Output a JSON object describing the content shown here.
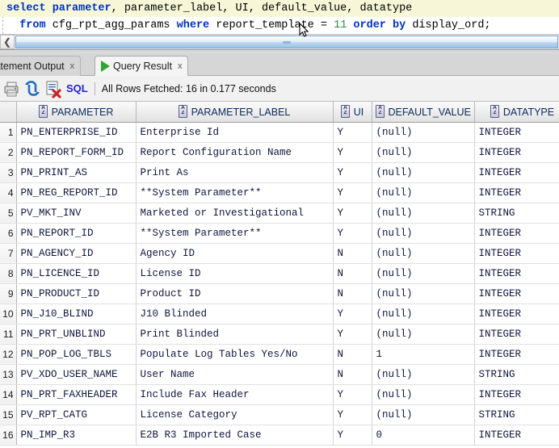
{
  "editor": {
    "line1": {
      "segments": [
        {
          "t": "select ",
          "k": true
        },
        {
          "t": "parameter",
          "k": true
        },
        {
          "t": ", parameter_label, UI, default_value, datatype",
          "k": false
        }
      ],
      "plain": "select parameter, parameter_label, UI, default_value, datatype"
    },
    "line2": {
      "plain": "  from cfg_rpt_agg_params where report_template = 11 order by display_ord;"
    },
    "scroll_left_icon": "chevron-left-icon"
  },
  "tabs": [
    {
      "label": "tatement Output",
      "close": "x",
      "active": false,
      "icon": null
    },
    {
      "label": "Query Result",
      "close": "x",
      "active": true,
      "icon": "play-icon"
    }
  ],
  "toolbar": {
    "icons": [
      "print-icon",
      "refresh-icon",
      "unpin-delete-icon"
    ],
    "sql_label": "SQL",
    "fetch_status": "All Rows Fetched: 16 in 0.177 seconds"
  },
  "grid": {
    "columns": [
      {
        "name": "PARAMETER",
        "icon": "sort-az-icon"
      },
      {
        "name": "PARAMETER_LABEL",
        "icon": "sort-az-icon"
      },
      {
        "name": "UI",
        "icon": "sort-az-icon"
      },
      {
        "name": "DEFAULT_VALUE",
        "icon": "sort-az-icon"
      },
      {
        "name": "DATATYPE",
        "icon": "sort-az-icon"
      }
    ],
    "rows": [
      {
        "n": "1",
        "parameter": "PN_ENTERPRISE_ID",
        "parameter_label": "Enterprise Id",
        "ui": "Y",
        "default_value": "(null)",
        "datatype": "INTEGER"
      },
      {
        "n": "2",
        "parameter": "PN_REPORT_FORM_ID",
        "parameter_label": "Report Configuration Name",
        "ui": "Y",
        "default_value": "(null)",
        "datatype": "INTEGER"
      },
      {
        "n": "3",
        "parameter": "PN_PRINT_AS",
        "parameter_label": "Print As",
        "ui": "Y",
        "default_value": "(null)",
        "datatype": "INTEGER"
      },
      {
        "n": "4",
        "parameter": "PN_REG_REPORT_ID",
        "parameter_label": "**System Parameter**",
        "ui": "Y",
        "default_value": "(null)",
        "datatype": "INTEGER"
      },
      {
        "n": "5",
        "parameter": "PV_MKT_INV",
        "parameter_label": "Marketed or Investigational",
        "ui": "Y",
        "default_value": "(null)",
        "datatype": "STRING"
      },
      {
        "n": "6",
        "parameter": "PN_REPORT_ID",
        "parameter_label": "**System Parameter**",
        "ui": "Y",
        "default_value": "(null)",
        "datatype": "INTEGER"
      },
      {
        "n": "7",
        "parameter": "PN_AGENCY_ID",
        "parameter_label": "Agency ID",
        "ui": "N",
        "default_value": "(null)",
        "datatype": "INTEGER"
      },
      {
        "n": "8",
        "parameter": "PN_LICENCE_ID",
        "parameter_label": "License ID",
        "ui": "N",
        "default_value": "(null)",
        "datatype": "INTEGER"
      },
      {
        "n": "9",
        "parameter": "PN_PRODUCT_ID",
        "parameter_label": "Product ID",
        "ui": "N",
        "default_value": "(null)",
        "datatype": "INTEGER"
      },
      {
        "n": "10",
        "parameter": "PN_J10_BLIND",
        "parameter_label": "J10 Blinded",
        "ui": "Y",
        "default_value": "(null)",
        "datatype": "INTEGER"
      },
      {
        "n": "11",
        "parameter": "PN_PRT_UNBLIND",
        "parameter_label": "Print Blinded",
        "ui": "Y",
        "default_value": "(null)",
        "datatype": "INTEGER"
      },
      {
        "n": "12",
        "parameter": "PN_POP_LOG_TBLS",
        "parameter_label": "Populate Log Tables Yes/No",
        "ui": "N",
        "default_value": "1",
        "datatype": "INTEGER"
      },
      {
        "n": "13",
        "parameter": "PV_XDO_USER_NAME",
        "parameter_label": "User Name",
        "ui": "N",
        "default_value": "(null)",
        "datatype": "STRING"
      },
      {
        "n": "14",
        "parameter": "PN_PRT_FAXHEADER",
        "parameter_label": "Include Fax Header",
        "ui": "Y",
        "default_value": "(null)",
        "datatype": "INTEGER"
      },
      {
        "n": "15",
        "parameter": "PV_RPT_CATG",
        "parameter_label": "License Category",
        "ui": "Y",
        "default_value": "(null)",
        "datatype": "STRING"
      },
      {
        "n": "16",
        "parameter": "PN_IMP_R3",
        "parameter_label": "E2B R3 Imported Case",
        "ui": "Y",
        "default_value": "0",
        "datatype": "INTEGER"
      }
    ]
  },
  "colors": {
    "sql_keyword": "#0033bb",
    "sql_number": "#2b8a3e",
    "line_highlight": "#f7f7d8",
    "header_text": "#0a2a5e",
    "cell_text": "#10173d",
    "sql_label": "#2222cc"
  }
}
